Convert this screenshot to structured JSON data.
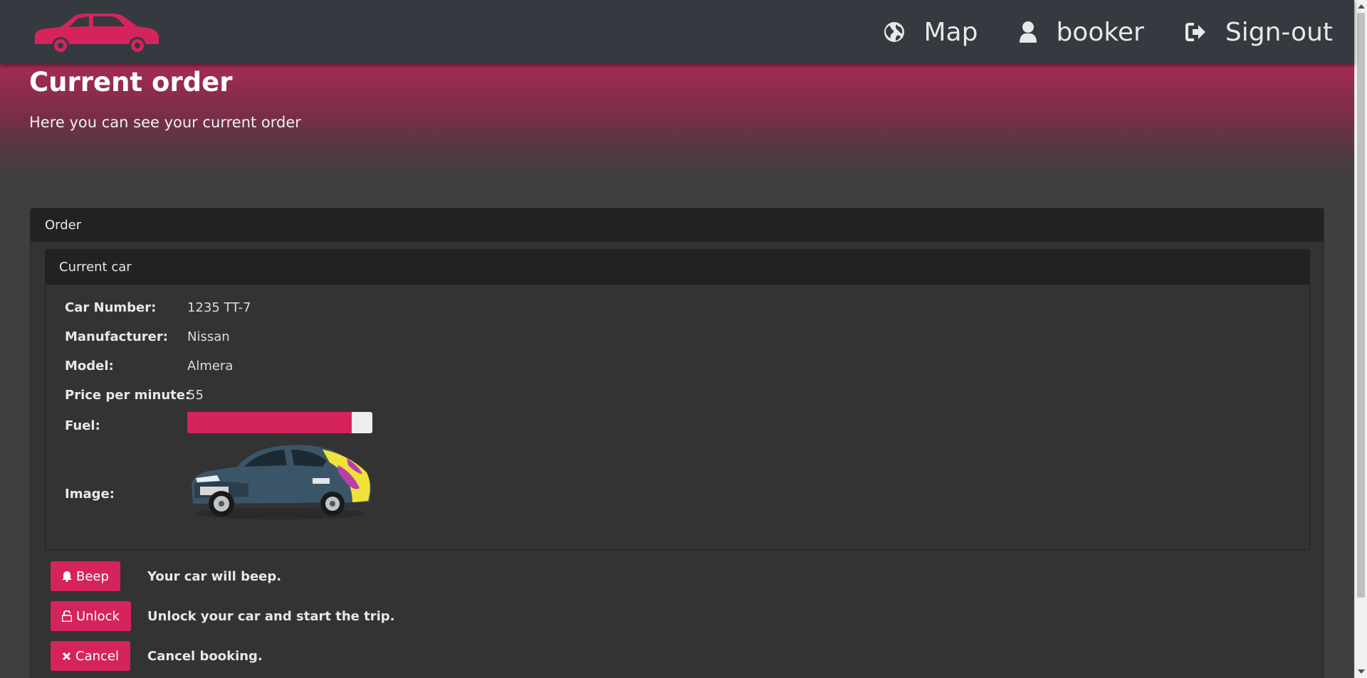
{
  "nav": {
    "logo_icon": "car-logo-icon",
    "items": [
      {
        "label": "Map",
        "icon": "globe-icon"
      },
      {
        "label": "booker",
        "icon": "user-icon"
      },
      {
        "label": "Sign-out",
        "icon": "sign-out-icon"
      }
    ]
  },
  "hero": {
    "title": "Current order",
    "subtitle": "Here you can see your current order"
  },
  "order": {
    "panel_title": "Order",
    "car_panel_title": "Current car",
    "fields": [
      {
        "label": "Car Number:",
        "value": "1235 TT-7"
      },
      {
        "label": "Manufacturer:",
        "value": "Nissan"
      },
      {
        "label": "Model:",
        "value": "Almera"
      },
      {
        "label": "Price per minute:",
        "value": "55"
      }
    ],
    "fuel_label": "Fuel:",
    "fuel_level": 0.89,
    "image_label": "Image:"
  },
  "actions": [
    {
      "label": "Beep",
      "icon": "bell-icon",
      "description": "Your car will beep."
    },
    {
      "label": "Unlock",
      "icon": "unlock-icon",
      "description": "Unlock your car and start the trip."
    },
    {
      "label": "Cancel",
      "icon": "close-icon",
      "description": "Cancel booking."
    }
  ],
  "colors": {
    "accent": "#d5245c",
    "navbar": "#343a3f",
    "background": "#3f3f3f",
    "panel_heading": "#222222"
  }
}
